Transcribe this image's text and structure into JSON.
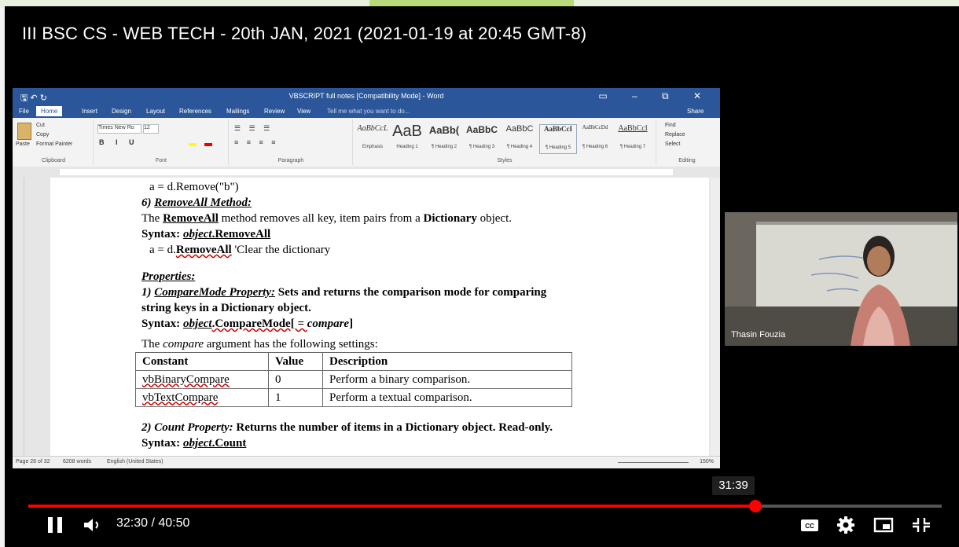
{
  "video": {
    "title": "III BSC CS - WEB TECH - 20th JAN, 2021 (2021-01-19 at 20:45 GMT-8)",
    "current_time": "32:30",
    "duration": "40:50",
    "time_display": "32:30 / 40:50",
    "hover_time": "31:39",
    "progress_fraction": 0.796,
    "accent_color": "#ff0000"
  },
  "word": {
    "window_title": "VBSCRIPT full notes [Compatibility Mode] - Word",
    "tabs": [
      "File",
      "Home",
      "Insert",
      "Design",
      "Layout",
      "References",
      "Mailings",
      "Review",
      "View"
    ],
    "active_tab": "Home",
    "tell_me": "Tell me what you want to do...",
    "share_label": "Share",
    "clipboard": {
      "paste": "Paste",
      "cut": "Cut",
      "copy": "Copy",
      "format_painter": "Format Painter",
      "label": "Clipboard"
    },
    "font": {
      "name": "Times New Ro",
      "size": "12",
      "label": "Font"
    },
    "paragraph_label": "Paragraph",
    "styles": [
      {
        "preview": "AaBbCcL",
        "name": "Emphasis"
      },
      {
        "preview": "AaB",
        "name": "Heading 1"
      },
      {
        "preview": "AaBb(",
        "name": "¶ Heading 2"
      },
      {
        "preview": "AaBbC",
        "name": "¶ Heading 3"
      },
      {
        "preview": "AaBbC",
        "name": "¶ Heading 4"
      },
      {
        "preview": "AaBbCcI",
        "name": "¶ Heading 5"
      },
      {
        "preview": "AaBbCcDd",
        "name": "¶ Heading 6"
      },
      {
        "preview": "AaBbCcl",
        "name": "¶ Heading 7"
      }
    ],
    "styles_label": "Styles",
    "editing": {
      "find": "Find",
      "replace": "Replace",
      "select": "Select",
      "label": "Editing"
    },
    "status": {
      "page": "Page 28 of 32",
      "words": "6208 words",
      "language": "English (United States)",
      "zoom": "150%"
    }
  },
  "doc": {
    "l1": "a = d.Remove(\"b\")",
    "l2_num": "6) ",
    "l2_name": "RemoveAll Method:",
    "l3_a": "The ",
    "l3_b": "RemoveAll",
    "l3_c": " method removes all key, item pairs from a ",
    "l3_d": "Dictionary",
    "l3_e": " object.",
    "l4_a": "Syntax: ",
    "l4_b": "object",
    "l4_c": ".RemoveAll",
    "l5_a": "a = d.",
    "l5_b": "RemoveAll",
    "l5_c": " 'Clear the dictionary",
    "l6": "Properties:",
    "l7_a": "1) ",
    "l7_b": "CompareMode Property:",
    "l7_c": " Sets and returns the comparison mode for comparing",
    "l8": "string keys in a Dictionary object.",
    "l9_a": "Syntax:  ",
    "l9_b": "object",
    "l9_c": ".CompareMode[ = ",
    "l9_d": "compare",
    "l9_e": "]",
    "l10_a": "The ",
    "l10_b": "compare",
    "l10_c": " argument has the following settings:",
    "table": {
      "headers": [
        "Constant",
        "Value",
        "Description"
      ],
      "rows": [
        [
          "vbBinaryCompare",
          "0",
          "Perform a binary comparison."
        ],
        [
          "vbTextCompare",
          "1",
          "Perform a textual comparison."
        ]
      ]
    },
    "l11_a": "2) Count Property:",
    "l11_b": " Returns the number of items in a Dictionary object. Read-only.",
    "l12_a": "Syntax:  ",
    "l12_b": "object",
    "l12_c": ".Count"
  },
  "participant": {
    "name": "Thasin Fouzia"
  },
  "controls": {
    "icons": [
      "pause-icon",
      "volume-icon",
      "subtitles-icon",
      "settings-icon",
      "miniplayer-icon",
      "exit-fullscreen-icon"
    ]
  }
}
